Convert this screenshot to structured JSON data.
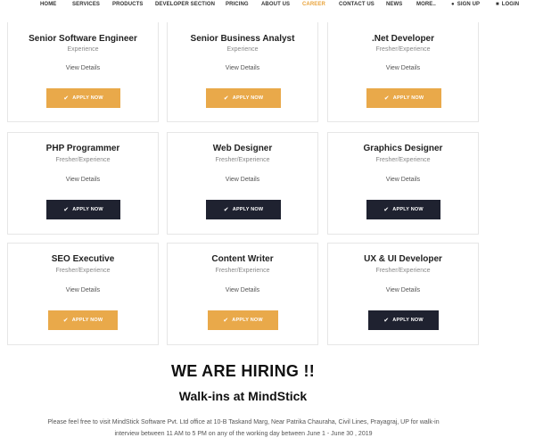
{
  "nav": {
    "items": [
      "HOME",
      "SERVICES",
      "PRODUCTS",
      "DEVELOPER SECTION",
      "PRICING",
      "ABOUT US",
      "CAREER",
      "CONTACT US",
      "NEWS",
      "MORE.."
    ],
    "active": "CAREER",
    "signup": "SIGN UP",
    "login": "LOGIN",
    "accent": "#e9a33a"
  },
  "jobs": [
    {
      "title": "Senior Software Engineer",
      "experience": "Experience",
      "view": "View Details",
      "button": "APPLY NOW",
      "style": "gold"
    },
    {
      "title": "Senior Business Analyst",
      "experience": "Experience",
      "view": "View Details",
      "button": "APPLY NOW",
      "style": "gold"
    },
    {
      "title": ".Net Developer",
      "experience": "Fresher/Experience",
      "view": "View Details",
      "button": "APPLY NOW",
      "style": "gold"
    },
    {
      "title": "PHP Programmer",
      "experience": "Fresher/Experience",
      "view": "View Details",
      "button": "APPLY NOW",
      "style": "dark"
    },
    {
      "title": "Web Designer",
      "experience": "Fresher/Experience",
      "view": "View Details",
      "button": "APPLY NOW",
      "style": "dark"
    },
    {
      "title": "Graphics Designer",
      "experience": "Fresher/Experience",
      "view": "View Details",
      "button": "APPLY NOW",
      "style": "dark"
    },
    {
      "title": "SEO Executive",
      "experience": "Fresher/Experience",
      "view": "View Details",
      "button": "APPLY NOW",
      "style": "gold"
    },
    {
      "title": "Content Writer",
      "experience": "Fresher/Experience",
      "view": "View Details",
      "button": "APPLY NOW",
      "style": "gold"
    },
    {
      "title": "UX & UI Developer",
      "experience": "Fresher/Experience",
      "view": "View Details",
      "button": "APPLY NOW",
      "style": "dark"
    }
  ],
  "hiring": {
    "heading": "WE ARE HIRING !!",
    "subheading": "Walk-ins at MindStick",
    "line1": "Please feel free to visit MindStick Software Pvt. Ltd office at 10-B Taskand Marg, Near Patrika Chauraha, Civil Lines, Prayagraj, UP for walk-in",
    "line2": "interview between 11 AM to 5 PM on any of the working day between June 1 - June 30 , 2019"
  },
  "colors": {
    "gold": "#e9a94a",
    "dark": "#1f2230"
  }
}
